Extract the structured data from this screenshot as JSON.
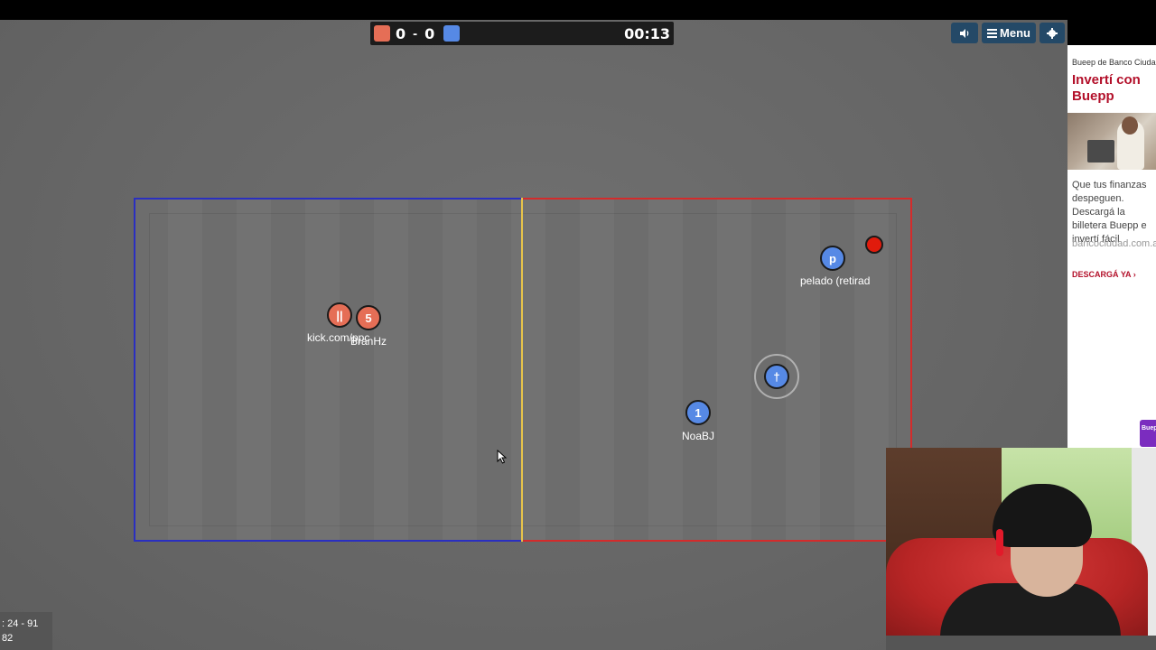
{
  "scoreboard": {
    "red_score": "0",
    "separator": "-",
    "blue_score": "0",
    "timer": "00:13",
    "colors": {
      "red": "#e56e56",
      "blue": "#5689e5"
    }
  },
  "toolbar": {
    "sound_icon": "speaker-icon",
    "menu_label": "Menu",
    "settings_icon": "gear-icon"
  },
  "field": {
    "left_wall_color": "#2a2fc0",
    "right_wall_color": "#d42b2b",
    "mid_line_color": "#e8c44a"
  },
  "players": {
    "red_1": {
      "avatar": "||",
      "name": "kick.com/ppc"
    },
    "red_2": {
      "avatar": "5",
      "name": "BranHz"
    },
    "blue_1": {
      "avatar": "p",
      "name": "pelado (retirad"
    },
    "blue_2": {
      "avatar": "†",
      "name": ""
    },
    "blue_3": {
      "avatar": "1",
      "name": "NoaBJ"
    }
  },
  "ball": {
    "color": "#e11b0c"
  },
  "stats": {
    "line1": ": 24 - 91",
    "line2": "82"
  },
  "ad": {
    "source": "Bueep de Banco Ciudad",
    "headline": "Invertí con Buepp",
    "body": "Que tus finanzas despeguen. Descargá la billetera Buepp e invertí fácil",
    "url": "bancociudad.com.ar",
    "cta": "DESCARGÁ YA",
    "badge": "Buepp"
  }
}
